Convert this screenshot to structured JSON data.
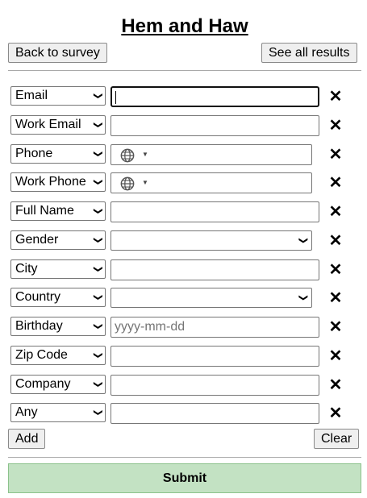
{
  "page": {
    "title": "Hem and Haw",
    "back_label": "Back to survey",
    "results_label": "See all results",
    "add_label": "Add",
    "clear_label": "Clear",
    "submit_label": "Submit",
    "remove_glyph": "✕"
  },
  "rows": [
    {
      "type": "Email",
      "kind": "text",
      "value": "",
      "focused": true
    },
    {
      "type": "Work Email",
      "kind": "text",
      "value": ""
    },
    {
      "type": "Phone",
      "kind": "phone",
      "value": "",
      "icon": "globe-icon"
    },
    {
      "type": "Work Phone",
      "kind": "phone",
      "value": "",
      "icon": "globe-icon"
    },
    {
      "type": "Full Name",
      "kind": "text",
      "value": ""
    },
    {
      "type": "Gender",
      "kind": "dropdown",
      "value": ""
    },
    {
      "type": "City",
      "kind": "text",
      "value": ""
    },
    {
      "type": "Country",
      "kind": "dropdown",
      "value": ""
    },
    {
      "type": "Birthday",
      "kind": "text",
      "value": "",
      "placeholder": "yyyy-mm-dd"
    },
    {
      "type": "Zip Code",
      "kind": "text",
      "value": ""
    },
    {
      "type": "Company",
      "kind": "text",
      "value": ""
    },
    {
      "type": "Any",
      "kind": "text",
      "value": ""
    }
  ],
  "colors": {
    "submit_bg": "#c3e2c3",
    "button_bg": "#efefef"
  }
}
